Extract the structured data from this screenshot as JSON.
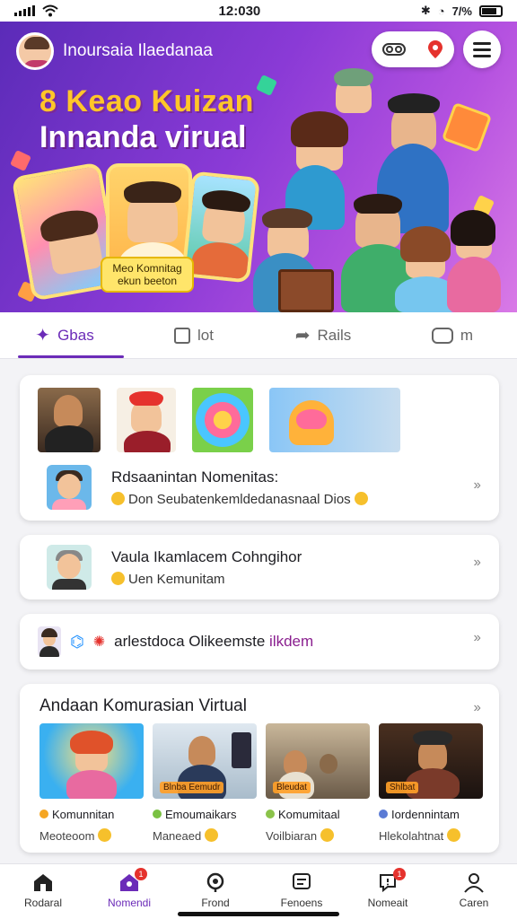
{
  "status_bar": {
    "time": "12:030",
    "battery": "7/%"
  },
  "header": {
    "brand": "Inoursaia Ilaedanaa"
  },
  "hero": {
    "headline_1": "8 Keao Kuizan",
    "headline_2": "Innanda virual",
    "card_label_1": "Meo Komnitag",
    "card_label_2": "ekun beeton"
  },
  "tabs": [
    {
      "label": "Gbas",
      "active": true
    },
    {
      "label": "lot",
      "active": false
    },
    {
      "label": "Rails",
      "active": false
    },
    {
      "label": "m",
      "active": false
    }
  ],
  "cards": {
    "card1": {
      "title": "Rdsaanintan Nomenitas:",
      "subtitle": "Don Seubatenkemldedanasnaal Dios"
    },
    "card2": {
      "title": "Vaula Ikamlacem Cohngihor",
      "subtitle": "Uen Kemunitam"
    },
    "card3": {
      "title": "arlestdoca Olikeemste",
      "highlight": "ilkdem"
    }
  },
  "section": {
    "title": "Andaan Komurasian Virtual",
    "videos": [
      {
        "badge": "",
        "name": "Komunnitan",
        "sub": "Meoteoom",
        "dot_color": "#f5a623"
      },
      {
        "badge": "Blnba Eemudr",
        "name": "Emoumaikars",
        "sub": "Maneaed",
        "dot_color": "#7ac143"
      },
      {
        "badge": "Bleudat",
        "name": "Komumitaal",
        "sub": "Voilbiaran",
        "dot_color": "#8bc34a"
      },
      {
        "badge": "Shlbat",
        "name": "Iordennintam",
        "sub": "Hlekolahtnat",
        "dot_color": "#5b7bd5"
      }
    ]
  },
  "bottom_nav": [
    {
      "label": "Rodaral",
      "icon": "home-icon",
      "active": false,
      "badge": ""
    },
    {
      "label": "Nomendi",
      "icon": "community-icon",
      "active": true,
      "badge": "1"
    },
    {
      "label": "Frond",
      "icon": "search-icon",
      "active": false,
      "badge": ""
    },
    {
      "label": "Fenoens",
      "icon": "chat-icon",
      "active": false,
      "badge": ""
    },
    {
      "label": "Nomeait",
      "icon": "notification-icon",
      "active": false,
      "badge": "1"
    },
    {
      "label": "Caren",
      "icon": "profile-icon",
      "active": false,
      "badge": ""
    }
  ],
  "colors": {
    "accent": "#6b2bb8",
    "hero_start": "#5b2bb8",
    "hero_end": "#d97ae6",
    "badge_red": "#e5322d"
  }
}
